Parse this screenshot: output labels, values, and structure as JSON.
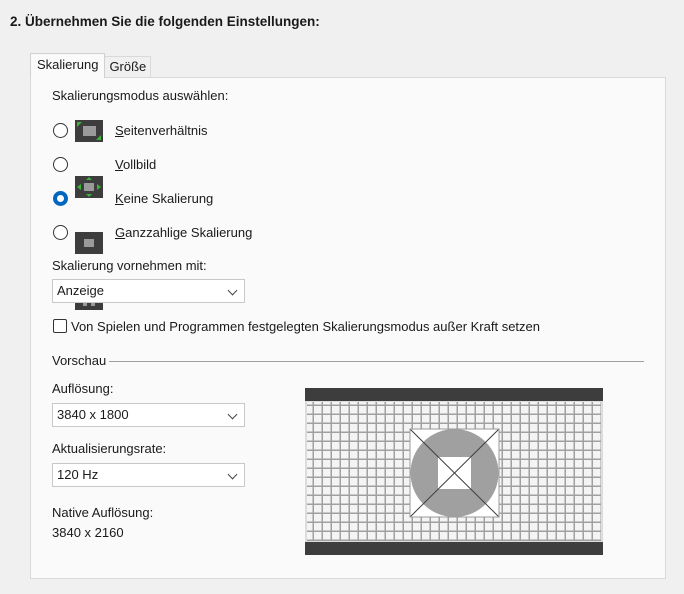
{
  "header": {
    "title": "2. Übernehmen Sie die folgenden Einstellungen:"
  },
  "tabs": [
    {
      "label": "Skalierung",
      "active": true
    },
    {
      "label": "Größe",
      "active": false
    }
  ],
  "scaling_mode": {
    "heading": "Skalierungsmodus auswählen:",
    "options": [
      {
        "access_key": "S",
        "label_rest": "eitenverhältnis",
        "icon": "aspect-ratio-icon",
        "selected": false
      },
      {
        "access_key": "V",
        "label_rest": "ollbild",
        "icon": "fullscreen-icon",
        "selected": false
      },
      {
        "access_key": "K",
        "label_rest": "eine Skalierung",
        "icon": "no-scaling-icon",
        "selected": true
      },
      {
        "access_key": "G",
        "label_rest": "anzzahlige Skalierung",
        "icon": "integer-scaling-icon",
        "selected": false
      }
    ]
  },
  "perform_scaling": {
    "label": "Skalierung vornehmen mit:",
    "value": "Anzeige"
  },
  "override": {
    "label": "Von Spielen und Programmen festgelegten Skalierungsmodus außer Kraft setzen",
    "checked": false
  },
  "preview": {
    "heading": "Vorschau",
    "resolution": {
      "label": "Auflösung:",
      "value": "3840 x 1800"
    },
    "refresh_rate": {
      "label": "Aktualisierungsrate:",
      "value": "120 Hz"
    },
    "native": {
      "label": "Native Auflösung:",
      "value": "3840 x 2160"
    }
  },
  "colors": {
    "accent": "#0067c0",
    "icon_green": "#3ab53a",
    "icon_bg": "#3d3d3d"
  }
}
